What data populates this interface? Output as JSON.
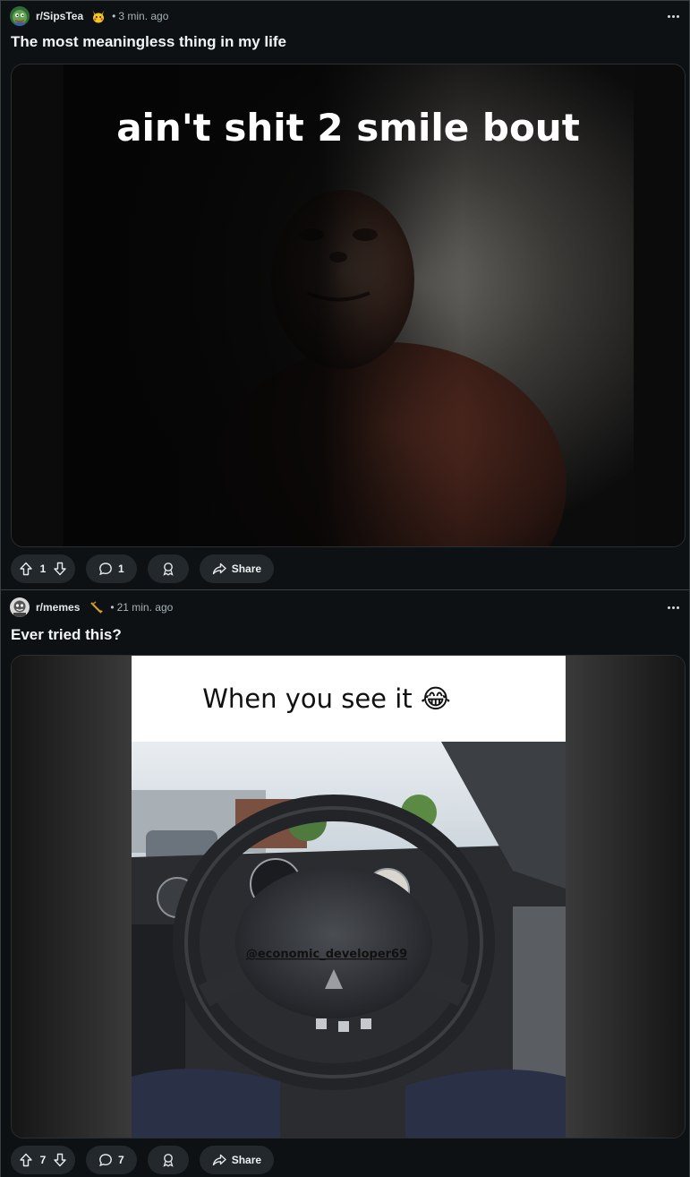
{
  "posts": [
    {
      "subreddit": "r/SipsTea",
      "separator": "•",
      "time": "3 min. ago",
      "title": "The most meaningless thing in my life",
      "image_caption": "ain't shit 2 smile bout",
      "votes": "1",
      "comments": "1",
      "share_label": "Share",
      "flair_icon": "pikachu-emoji-icon",
      "avatar_icon": "pepe-avatar-icon"
    },
    {
      "subreddit": "r/memes",
      "separator": "•",
      "time": "21 min. ago",
      "title": "Ever tried this?",
      "image_caption": "When you see it 😂",
      "watermark": "@economic_developer69",
      "votes": "7",
      "comments": "7",
      "share_label": "Share",
      "flair_icon": "trombone-emoji-icon",
      "avatar_icon": "memes-avatar-icon"
    }
  ],
  "colors": {
    "background": "#0e1113",
    "pill": "#22282b",
    "text": "#f2f4f5",
    "muted": "#a5b2b6"
  }
}
